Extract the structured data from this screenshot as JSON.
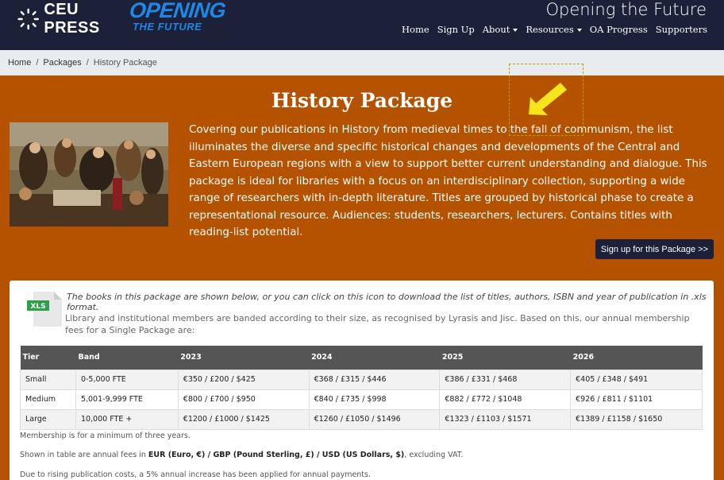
{
  "header": {
    "logo_text": "CEU PRESS",
    "opening_big": "OPENING",
    "opening_small": "THE FUTURE",
    "tagline": "Opening the Future",
    "nav": [
      "Home",
      "Sign Up",
      "About",
      "Resources",
      "OA Progress",
      "Supporters"
    ]
  },
  "breadcrumb": {
    "home": "Home",
    "packages": "Packages",
    "current": "History Package"
  },
  "hero": {
    "title": "History Package",
    "description": "Covering our publications in History from medieval times to the fall of communism, the list illuminates the diverse and specific historical changes and developments of the Central and Eastern European regions with a view to support better current understanding and dialogue. This package is ideal for libraries with a focus on an interdisciplinary collection, supporting a wide range of researchers with in-depth literature. Titles are grouped by historical phase to create a representational resource. Audiences: students, researchers, lecturers. Contains titles with reading-list potential.",
    "signup_button": "Sign up for this Package >>"
  },
  "panel": {
    "xls_label": "XLS",
    "intro": "The books in this package are shown below, or you can click on this icon to download the list of titles, authors, ISBN and year of publication in .xls format.",
    "intro2": "Library and institutional members are banded according to their size, as recognised by Lyrasis and Jisc. Based on this, our annual membership fees for a Single Package are:",
    "table": {
      "headers": [
        "Tier",
        "Band",
        "2023",
        "2024",
        "2025",
        "2026"
      ],
      "rows": [
        [
          "Small",
          "0-5,000 FTE",
          "€350 / £200 / $425",
          "€368 / £315 / $446",
          "€386 / £331 / $468",
          "€405 / £348 / $491"
        ],
        [
          "Medium",
          "5,001-9,999 FTE",
          "€800 / £700 / $950",
          "€840 / £735 / $998",
          "€882 / £772 / $1048",
          "€926 / £811 / $1101"
        ],
        [
          "Large",
          "10,000 FTE +",
          "€1200 / £1000 / $1425",
          "€1260 / £1050 / $1496",
          "€1323 / £1103 / $1571",
          "€1389 / £1158 / $1650"
        ]
      ]
    },
    "note1": "Membership is for a minimum of three years.",
    "note2_prefix": "Shown in table are annual fees in ",
    "note2_bold": "EUR (Euro, €) / GBP (Pound Sterling, £) / USD (US Dollars, $)",
    "note2_suffix": ", excluding VAT.",
    "note3": "Due to rising publication costs, a 5% annual increase has been applied for annual payments."
  },
  "colors": {
    "header_bg": "#1c2039",
    "hero_bg": "#b55200",
    "accent_blue": "#1e88e5",
    "arrow_yellow": "#f6e51a"
  }
}
